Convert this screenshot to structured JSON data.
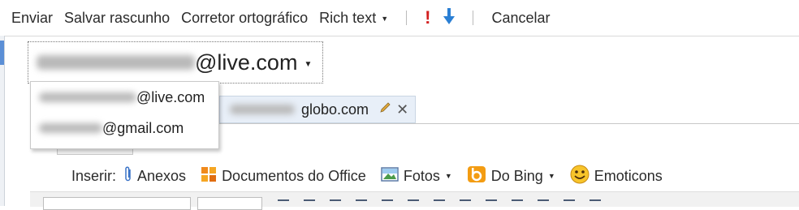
{
  "toolbar": {
    "send_label": "Enviar",
    "save_draft_label": "Salvar rascunho",
    "spellcheck_label": "Corretor ortográfico",
    "richtext_label": "Rich text",
    "cancel_label": "Cancelar",
    "importance_high_icon": "exclamation-icon",
    "importance_low_icon": "down-arrow-icon",
    "colors": {
      "high": "#d21f1f",
      "low": "#2a7fd4"
    }
  },
  "from": {
    "selected_suffix": "@live.com",
    "options": [
      {
        "suffix": "@live.com"
      },
      {
        "suffix": "@gmail.com"
      }
    ]
  },
  "to": {
    "recipient_suffix": "globo.com"
  },
  "insert": {
    "label": "Inserir:",
    "attachments_label": "Anexos",
    "office_docs_label": "Documentos do Office",
    "photos_label": "Fotos",
    "bing_label": "Do Bing",
    "emoticons_label": "Emoticons"
  }
}
